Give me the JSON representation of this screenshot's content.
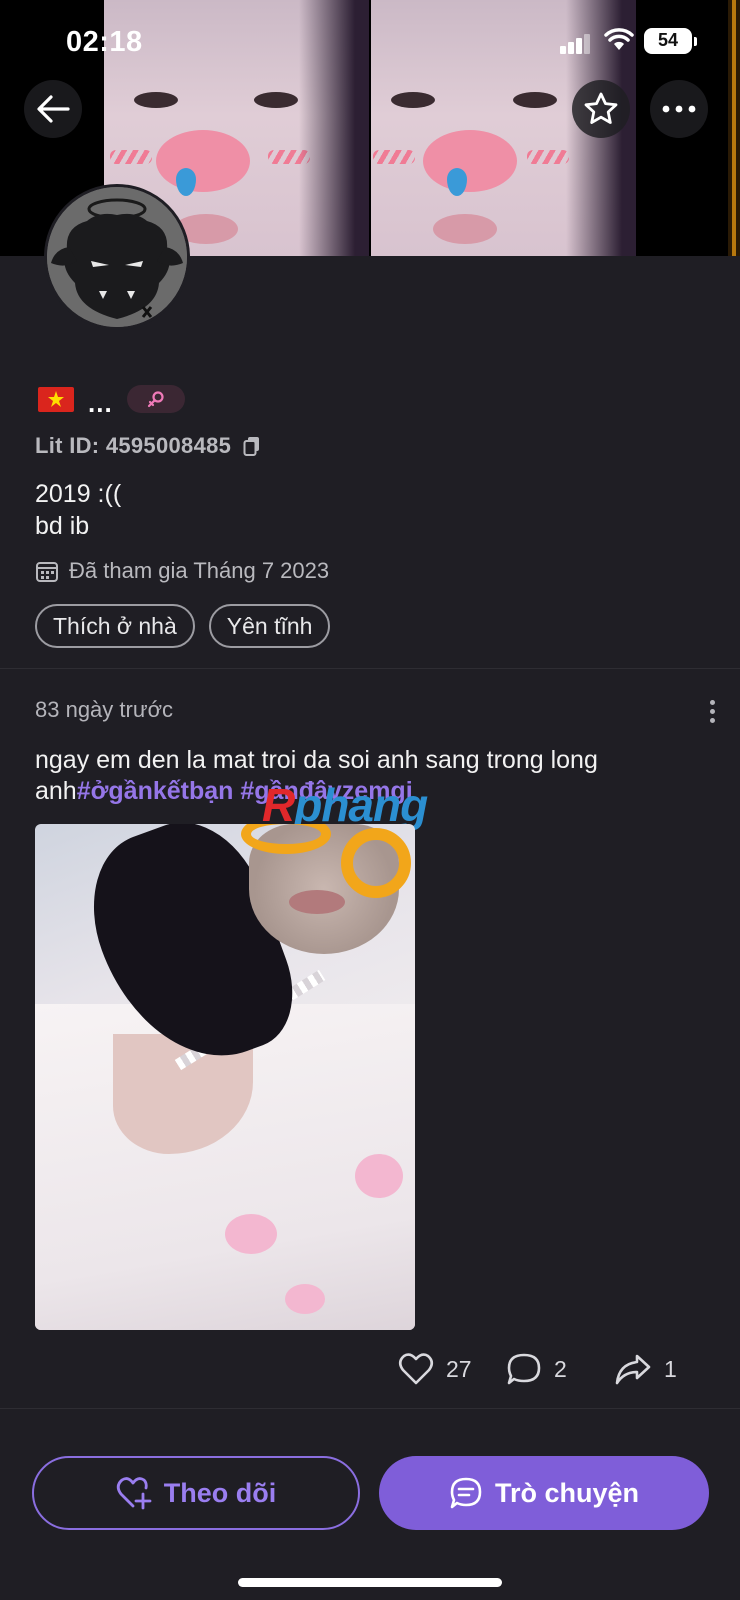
{
  "status_bar": {
    "time": "02:18",
    "battery": "54"
  },
  "header": {
    "back_icon": "arrow-left-icon",
    "star_icon": "star-outline-icon",
    "more_icon": "ellipsis-icon"
  },
  "profile": {
    "flag": "vietnam-flag-icon",
    "name": "...",
    "gender_icon": "female-symbol-icon",
    "lit_id": "Lit ID: 4595008485",
    "bio_line1": "2019 :((",
    "bio_line2": "bd ib",
    "joined": "Đã tham gia Tháng 7 2023",
    "tags": [
      "Thích ở nhà",
      "Yên tĩnh"
    ]
  },
  "post": {
    "time": "83 ngày trước",
    "text": "ngay em den la mat troi da soi anh sang trong long anh",
    "hashtags": [
      "#ởgầnkếtbạn",
      "#gầnđâyzemgi"
    ],
    "watermark_r": "R",
    "watermark_rest": "phang",
    "likes": "27",
    "comments": "2",
    "shares": "1"
  },
  "bottom": {
    "follow_label": "Theo dõi",
    "chat_label": "Trò chuyện"
  },
  "colors": {
    "background": "#1f1e24",
    "accent": "#7f5ed9",
    "hashtag": "#9576e8"
  }
}
